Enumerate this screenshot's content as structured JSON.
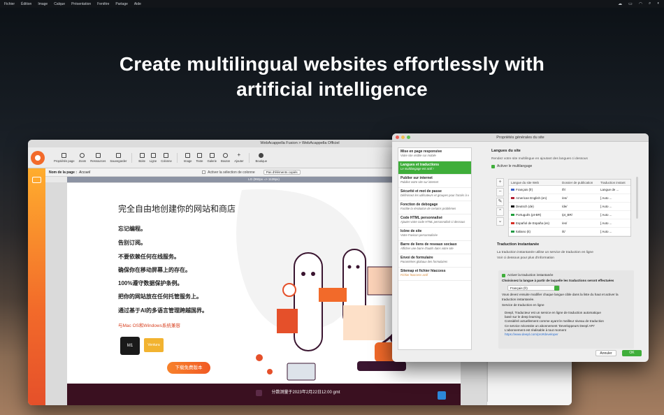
{
  "menubar": {
    "items": [
      "Fichier",
      "Édition",
      "Image",
      "Calque",
      "Présentation",
      "Fenêtre",
      "Partage",
      "Aide"
    ]
  },
  "headline": {
    "line1": "Create multilingual websites effortlessly with",
    "line2": "artificial intelligence"
  },
  "main_window": {
    "title": "WebAcappella Fusion > WebAcappella Officiel",
    "toolbar": [
      {
        "label": "Propriétés page"
      },
      {
        "label": "Zoom"
      },
      {
        "label": "Ressources"
      },
      {
        "label": "Sauvegarder"
      },
      {
        "label": "Boite"
      },
      {
        "label": "Ligne"
      },
      {
        "label": "Colonne"
      },
      {
        "label": "Image"
      },
      {
        "label": "Texte"
      },
      {
        "label": "Galerie"
      },
      {
        "label": "Bouton"
      },
      {
        "label": "Ajouter"
      },
      {
        "label": "Boutique"
      }
    ],
    "page_name_label": "Nom de la page :",
    "page_name_value": "Accueil",
    "column_select_label": "Activer la sélection de colonne",
    "copied_elements": "Pas d'éléments copiés",
    "ruler": "LG (992px => 1128px)",
    "page": {
      "title": "完全自由地创建你的网站和商店",
      "features": [
        "忘记编程。",
        "告别订阅。",
        "不要依赖任何在线服务。",
        "确保你在移动屏幕上的存在。",
        "100%遵守数据保护条例。",
        "把你的网站放在任何托管服务上。",
        "通过基于AI的多语言管理跨越国界。"
      ],
      "compat": "与Mac OS和Windows系统兼容",
      "badge_m1": "M1",
      "badge_ventura": "Ventura",
      "download": "下载免费版本",
      "footer": "分数测量于2023年2月22日12:00 gmt"
    }
  },
  "dialog": {
    "title": "Propriétés générales du site",
    "nav": [
      {
        "title": "Mise en page responsive",
        "sub": "Votre site visible sur mobile"
      },
      {
        "title": "Langues et traductions",
        "sub": "Le multilangage est actif !"
      },
      {
        "title": "Publier sur internet",
        "sub": "Publiez votre site sur internet"
      },
      {
        "title": "Sécurité et mot de passe",
        "sub": "Définissez les utilisateurs et groupes pour l'accès à v"
      },
      {
        "title": "Fonction de debogage",
        "sub": "Facilite la résolution de certains problèmes"
      },
      {
        "title": "Code HTML personnalisé",
        "sub": "Ajouter votre code HTML personnalisé ci dessous"
      },
      {
        "title": "Icône de site",
        "sub": "Votre Favicon personnalisée"
      },
      {
        "title": "Barre de liens de reseaux sociaux",
        "sub": "Afficher une barre d'outils dans votre site"
      },
      {
        "title": "Envoi de formulaire",
        "sub": "Paramètres globaux des formulaires"
      },
      {
        "title": "Sitemap et fichier htaccess",
        "sub": "Fichier htaccess actif"
      }
    ],
    "languages_heading": "Langues du site",
    "languages_desc": "Rendez votre site multilingue en ajoutant des langues ci dessous",
    "enable_multilang": "Activer le multilangage",
    "table_headers": [
      "Langue du site Web",
      "Dossier de publication",
      "Traduction instant"
    ],
    "table_rows": [
      {
        "lang": "Français (fr)",
        "folder": "/fr/",
        "trans": "Langue de ..."
      },
      {
        "lang": "American English (en)",
        "folder": "/en/",
        "trans": "[ Auto ..."
      },
      {
        "lang": "Deutsch (de)",
        "folder": "/de/",
        "trans": "[ Auto ..."
      },
      {
        "lang": "Português (pt-BR)",
        "folder": "/pt_BR/",
        "trans": "[ Auto ..."
      },
      {
        "lang": "Español de España (es)",
        "folder": "/es/",
        "trans": "[ Auto ..."
      },
      {
        "lang": "Italiano (it)",
        "folder": "/it/",
        "trans": "[ Auto ..."
      }
    ],
    "instant_heading": "Traduction instantanée",
    "instant_desc1": "La traduction instantanée utilise un service de traduction en ligne",
    "instant_desc2": "Voir ci dessous pour plus d'information",
    "enable_instant": "Activer la traduction instantanée",
    "choose_lang": "Choisissez la langue à partir de laquelle les traductions seront effectuées",
    "selected_lang": "Français (fr)",
    "modify_note": "Vous devez ensuite modifier chaque langue cible dans la liste du haut et activer la traduction instantanée.",
    "service_heading": "Service de traduction en ligne",
    "service_lines": [
      "Deepl, Traducteur est un service en ligne de traduction automatique",
      "basé sur le deep learning",
      "Considéré actuellement comme ayant le meilleur niveau de traduction",
      "Ce service nécessite un abonnement 'Developpeurs Deepl API'",
      "L'abonnement est réalisable à tout moment"
    ],
    "service_link": "https://www.deepl.com/pro#developer",
    "cancel": "Annuler",
    "ok": "OK"
  },
  "colors": {
    "accent_green": "#3fae3a",
    "brand_orange": "#f26a2a",
    "footer_dark": "#3a1020"
  }
}
